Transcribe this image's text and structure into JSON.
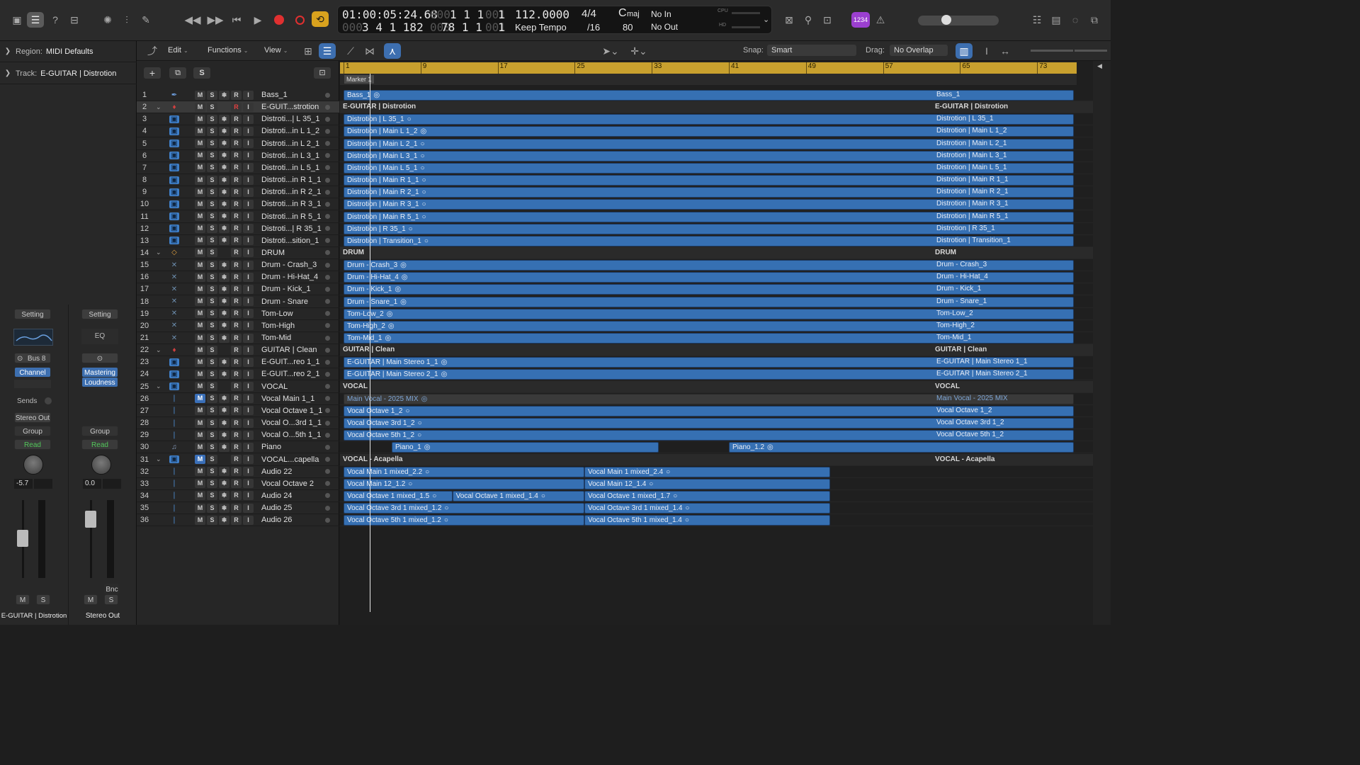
{
  "control_bar": {
    "lcd": {
      "position_time": "01:00:05:24.68",
      "position_bars": "1  1  1",
      "position_ticks": "1",
      "position_dim1": "000",
      "position_dim2": "001",
      "locator_bars": "3  4  1  182",
      "locator_dim": "000",
      "locator2": "78  1  1",
      "locator2_dim": "001",
      "locator2_ticks": "1",
      "tempo": "112.0000",
      "tempo_mode": "Keep Tempo",
      "signature": "4/4",
      "division": "/16",
      "key": "C",
      "key_mode": "maj",
      "key_value": "80",
      "midi_in": "No In",
      "midi_out": "No Out",
      "cpu_label": "CPU",
      "hd_label": "HD"
    },
    "count_in_label": "1234",
    "colors": {
      "record": "#e03030",
      "cycle": "#d9a21e",
      "badge": "#9b3fd0"
    }
  },
  "region_inspector": {
    "label": "Region:",
    "value": "MIDI Defaults"
  },
  "track_inspector": {
    "label": "Track:",
    "value": "E-GUITAR | Distrotion"
  },
  "channel_strips": [
    {
      "setting": "Setting",
      "link": "Bus 8",
      "insert": "Channel EQ",
      "sends": "Sends",
      "output": "Stereo Out",
      "group": "Group",
      "automation": "Read",
      "volume": "-5.7",
      "mute": "M",
      "solo": "S",
      "name": "E-GUITAR | Distrotion"
    },
    {
      "setting": "Setting",
      "eq": "EQ",
      "insert1": "Mastering",
      "insert2": "Loudness",
      "group": "Group",
      "automation": "Read",
      "volume": "0.0",
      "bounce": "Bnc",
      "mute": "M",
      "solo": "S",
      "name": "Stereo Out"
    }
  ],
  "arrange_toolbar": {
    "edit": "Edit",
    "functions": "Functions",
    "view": "View",
    "snap_label": "Snap:",
    "snap_value": "Smart",
    "drag_label": "Drag:",
    "drag_value": "No Overlap"
  },
  "track_header_buttons": {
    "add": "+",
    "solo": "S"
  },
  "ruler": {
    "bars": [
      "1",
      "9",
      "17",
      "25",
      "33",
      "41",
      "49",
      "57",
      "65",
      "73"
    ],
    "marker": "Marker 1"
  },
  "tracks": [
    {
      "n": "1",
      "name": "Bass_1",
      "icon": "bass",
      "r": "R"
    },
    {
      "n": "2",
      "name": "E-GUIT...strotion",
      "icon": "guitar",
      "r": "R",
      "folder": true,
      "selected": true
    },
    {
      "n": "3",
      "name": "Distroti...| L 35_1",
      "icon": "audio",
      "r": "R"
    },
    {
      "n": "4",
      "name": "Distroti...in L 1_2",
      "icon": "audio",
      "r": "R"
    },
    {
      "n": "5",
      "name": "Distroti...in L 2_1",
      "icon": "audio",
      "r": "R"
    },
    {
      "n": "6",
      "name": "Distroti...in L 3_1",
      "icon": "audio",
      "r": "R"
    },
    {
      "n": "7",
      "name": "Distroti...in L 5_1",
      "icon": "audio",
      "r": "R"
    },
    {
      "n": "8",
      "name": "Distroti...in R 1_1",
      "icon": "audio",
      "r": "R"
    },
    {
      "n": "9",
      "name": "Distroti...in R 2_1",
      "icon": "audio",
      "r": "R"
    },
    {
      "n": "10",
      "name": "Distroti...in R 3_1",
      "icon": "audio",
      "r": "R"
    },
    {
      "n": "11",
      "name": "Distroti...in R 5_1",
      "icon": "audio",
      "r": "R"
    },
    {
      "n": "12",
      "name": "Distroti...| R 35_1",
      "icon": "audio",
      "r": "R"
    },
    {
      "n": "13",
      "name": "Distroti...sition_1",
      "icon": "audio",
      "r": "R"
    },
    {
      "n": "14",
      "name": "DRUM",
      "icon": "drum",
      "r": "R",
      "folder": true
    },
    {
      "n": "15",
      "name": "Drum - Crash_3",
      "icon": "stick",
      "r": "R"
    },
    {
      "n": "16",
      "name": "Drum - Hi-Hat_4",
      "icon": "stick",
      "r": "R"
    },
    {
      "n": "17",
      "name": "Drum - Kick_1",
      "icon": "stick",
      "r": "R"
    },
    {
      "n": "18",
      "name": "Drum - Snare",
      "icon": "stick",
      "r": "R"
    },
    {
      "n": "19",
      "name": "Tom-Low",
      "icon": "stick",
      "r": "R"
    },
    {
      "n": "20",
      "name": "Tom-High",
      "icon": "stick",
      "r": "R"
    },
    {
      "n": "21",
      "name": "Tom-Mid",
      "icon": "stick",
      "r": "R"
    },
    {
      "n": "22",
      "name": "GUITAR | Clean",
      "icon": "guitar",
      "r": "R",
      "folder": true
    },
    {
      "n": "23",
      "name": "E-GUIT...reo 1_1",
      "icon": "audio",
      "r": "R"
    },
    {
      "n": "24",
      "name": "E-GUIT...reo 2_1",
      "icon": "audio",
      "r": "R"
    },
    {
      "n": "25",
      "name": "VOCAL",
      "icon": "audio",
      "r": "R",
      "folder": true
    },
    {
      "n": "26",
      "name": "Vocal Main 1_1",
      "icon": "mic",
      "r": "R",
      "mute_on": true
    },
    {
      "n": "27",
      "name": "Vocal Octave 1_1",
      "icon": "mic",
      "r": "R"
    },
    {
      "n": "28",
      "name": "Vocal O...3rd 1_1",
      "icon": "mic",
      "r": "R"
    },
    {
      "n": "29",
      "name": "Vocal O...5th 1_1",
      "icon": "mic",
      "r": "R"
    },
    {
      "n": "30",
      "name": "Piano",
      "icon": "piano",
      "r": "R"
    },
    {
      "n": "31",
      "name": "VOCAL...capella",
      "icon": "audio",
      "r": "R",
      "folder": true,
      "mute_on": true
    },
    {
      "n": "32",
      "name": "Audio 22",
      "icon": "mic",
      "r": "R"
    },
    {
      "n": "33",
      "name": "Vocal Octave 2",
      "icon": "mic",
      "r": "R"
    },
    {
      "n": "34",
      "name": "Audio 24",
      "icon": "mic",
      "r": "R"
    },
    {
      "n": "35",
      "name": "Audio 25",
      "icon": "mic",
      "r": "R"
    },
    {
      "n": "36",
      "name": "Audio 26",
      "icon": "mic",
      "r": "R"
    }
  ],
  "lanes": [
    {
      "regions": [
        {
          "t": "Bass_1",
          "s": 1,
          "e": 77,
          "loop": true
        }
      ],
      "right": "Bass_1"
    },
    {
      "folder": "E-GUITAR | Distrotion",
      "right_folder": "E-GUITAR | Distrotion"
    },
    {
      "regions": [
        {
          "t": "Distrotion | L 35_1",
          "s": 1,
          "e": 77
        }
      ],
      "right": "Distrotion | L 35_1"
    },
    {
      "regions": [
        {
          "t": "Distrotion | Main L 1_2",
          "s": 1,
          "e": 77,
          "loop": true
        }
      ],
      "right": "Distrotion | Main L 1_2"
    },
    {
      "regions": [
        {
          "t": "Distrotion | Main L 2_1",
          "s": 1,
          "e": 77
        }
      ],
      "right": "Distrotion | Main L 2_1"
    },
    {
      "regions": [
        {
          "t": "Distrotion | Main L 3_1",
          "s": 1,
          "e": 77
        }
      ],
      "right": "Distrotion | Main L 3_1"
    },
    {
      "regions": [
        {
          "t": "Distrotion | Main L 5_1",
          "s": 1,
          "e": 77
        }
      ],
      "right": "Distrotion | Main L 5_1"
    },
    {
      "regions": [
        {
          "t": "Distrotion | Main R 1_1",
          "s": 1,
          "e": 77
        }
      ],
      "right": "Distrotion | Main R 1_1"
    },
    {
      "regions": [
        {
          "t": "Distrotion | Main R 2_1",
          "s": 1,
          "e": 77
        }
      ],
      "right": "Distrotion | Main R 2_1"
    },
    {
      "regions": [
        {
          "t": "Distrotion | Main R 3_1",
          "s": 1,
          "e": 77
        }
      ],
      "right": "Distrotion | Main R 3_1"
    },
    {
      "regions": [
        {
          "t": "Distrotion | Main R 5_1",
          "s": 1,
          "e": 77
        }
      ],
      "right": "Distrotion | Main R 5_1"
    },
    {
      "regions": [
        {
          "t": "Distrotion | R 35_1",
          "s": 1,
          "e": 77
        }
      ],
      "right": "Distrotion | R 35_1"
    },
    {
      "regions": [
        {
          "t": "Distrotion | Transition_1",
          "s": 1,
          "e": 77
        }
      ],
      "right": "Distrotion | Transition_1"
    },
    {
      "folder": "DRUM",
      "right_folder": "DRUM"
    },
    {
      "regions": [
        {
          "t": "Drum - Crash_3",
          "s": 1,
          "e": 77,
          "loop": true
        }
      ],
      "right": "Drum - Crash_3"
    },
    {
      "regions": [
        {
          "t": "Drum - Hi-Hat_4",
          "s": 1,
          "e": 77,
          "loop": true
        }
      ],
      "right": "Drum - Hi-Hat_4"
    },
    {
      "regions": [
        {
          "t": "Drum - Kick_1",
          "s": 1,
          "e": 77,
          "loop": true
        }
      ],
      "right": "Drum - Kick_1"
    },
    {
      "regions": [
        {
          "t": "Drum - Snare_1",
          "s": 1,
          "e": 77,
          "loop": true
        }
      ],
      "right": "Drum - Snare_1"
    },
    {
      "regions": [
        {
          "t": "Tom-Low_2",
          "s": 1,
          "e": 77,
          "loop": true
        }
      ],
      "right": "Tom-Low_2"
    },
    {
      "regions": [
        {
          "t": "Tom-High_2",
          "s": 1,
          "e": 77,
          "loop": true
        }
      ],
      "right": "Tom-High_2"
    },
    {
      "regions": [
        {
          "t": "Tom-Mid_1",
          "s": 1,
          "e": 77,
          "loop": true
        }
      ],
      "right": "Tom-Mid_1"
    },
    {
      "folder": "GUITAR | Clean",
      "right_folder": "GUITAR | Clean"
    },
    {
      "regions": [
        {
          "t": "E-GUITAR | Main Stereo 1_1",
          "s": 1,
          "e": 77,
          "loop": true
        }
      ],
      "right": "E-GUITAR | Main Stereo 1_1"
    },
    {
      "regions": [
        {
          "t": "E-GUITAR | Main Stereo 2_1",
          "s": 1,
          "e": 77,
          "loop": true
        }
      ],
      "right": "E-GUITAR | Main Stereo 2_1"
    },
    {
      "folder": "VOCAL",
      "right_folder": "VOCAL"
    },
    {
      "regions": [
        {
          "t": "Main Vocal - 2025 MIX",
          "s": 1,
          "e": 77,
          "loop": true,
          "gray": true
        }
      ],
      "right": "Main Vocal - 2025 MIX",
      "right_gray": true
    },
    {
      "regions": [
        {
          "t": "Vocal Octave 1_2",
          "s": 1,
          "e": 77
        }
      ],
      "right": "Vocal Octave 1_2"
    },
    {
      "regions": [
        {
          "t": "Vocal Octave 3rd 1_2",
          "s": 1,
          "e": 77
        }
      ],
      "right": "Vocal Octave 3rd 1_2"
    },
    {
      "regions": [
        {
          "t": "Vocal Octave 5th 1_2",
          "s": 1,
          "e": 77
        }
      ],
      "right": "Vocal Octave 5th 1_2"
    },
    {
      "regions": [
        {
          "t": "Piano_1",
          "s": 6,
          "e": 33.7,
          "loop": true
        },
        {
          "t": "Piano_1.2",
          "s": 41,
          "e": 77,
          "loop": true
        }
      ]
    },
    {
      "folder": "VOCAL - Acapella",
      "right_folder": "VOCAL - Acapella"
    },
    {
      "regions": [
        {
          "t": "Vocal Main 1 mixed_2.2",
          "s": 1,
          "e": 26
        },
        {
          "t": "Vocal Main 1 mixed_2.4",
          "s": 26,
          "e": 51.5
        }
      ]
    },
    {
      "regions": [
        {
          "t": "Vocal Main 12_1.2",
          "s": 1,
          "e": 26
        },
        {
          "t": "Vocal Main 12_1.4",
          "s": 26,
          "e": 51.5
        }
      ]
    },
    {
      "regions": [
        {
          "t": "Vocal Octave 1 mixed_1.5",
          "s": 1,
          "e": 12.3
        },
        {
          "t": "Vocal Octave 1 mixed_1.4",
          "s": 12.3,
          "e": 26
        },
        {
          "t": "Vocal Octave 1 mixed_1.7",
          "s": 26,
          "e": 51.5
        }
      ]
    },
    {
      "regions": [
        {
          "t": "Vocal Octave 3rd 1 mixed_1.2",
          "s": 1,
          "e": 26
        },
        {
          "t": "Vocal Octave 3rd 1 mixed_1.4",
          "s": 26,
          "e": 51.5
        }
      ]
    },
    {
      "regions": [
        {
          "t": "Vocal Octave 5th 1 mixed_1.2",
          "s": 1,
          "e": 26
        },
        {
          "t": "Vocal Octave 5th 1 mixed_1.4",
          "s": 26,
          "e": 51.5
        }
      ]
    }
  ]
}
